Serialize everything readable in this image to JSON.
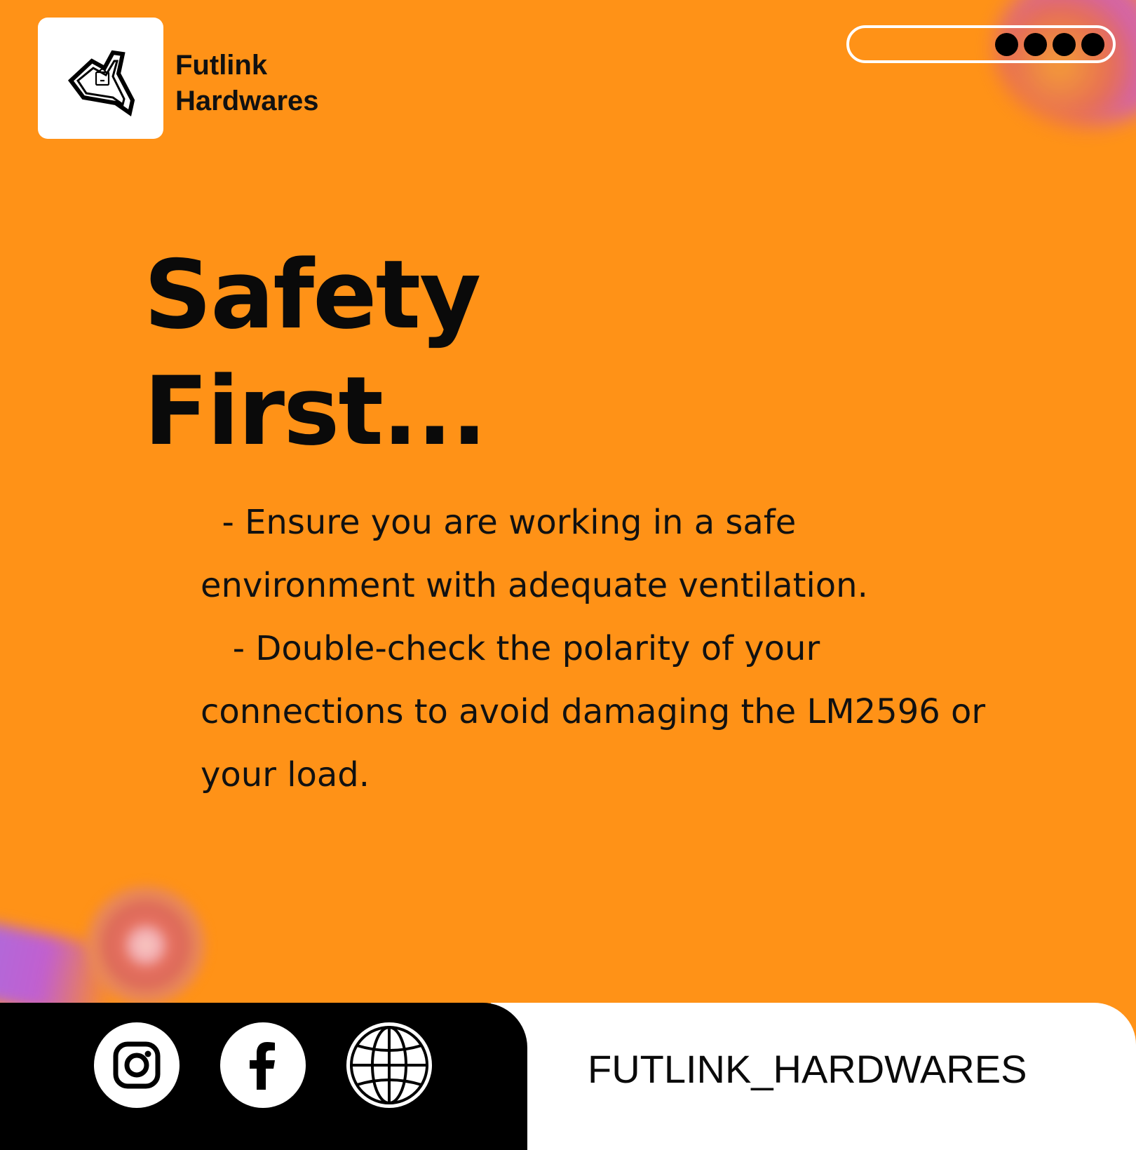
{
  "brand": {
    "line1": "Futlink",
    "line2": "Hardwares",
    "logo_icon": "shopping-bag-triangle-logo"
  },
  "progress": {
    "total_dots": 4,
    "filled_dots": 4
  },
  "headline": {
    "line1": "Safety",
    "line2": "First..."
  },
  "body": {
    "lines": [
      "  - Ensure you are working in a safe",
      "environment with adequate ventilation.",
      "   - Double-check the polarity of your",
      "connections to avoid damaging the LM2596 or",
      "your load."
    ]
  },
  "footer": {
    "icons": [
      "instagram-icon",
      "facebook-icon",
      "globe-icon"
    ],
    "handle": "FUTLINK_HARDWARES"
  },
  "colors": {
    "background": "#FF9217",
    "text": "#111111",
    "footer_dark": "#000000",
    "footer_light": "#FFFFFF"
  }
}
